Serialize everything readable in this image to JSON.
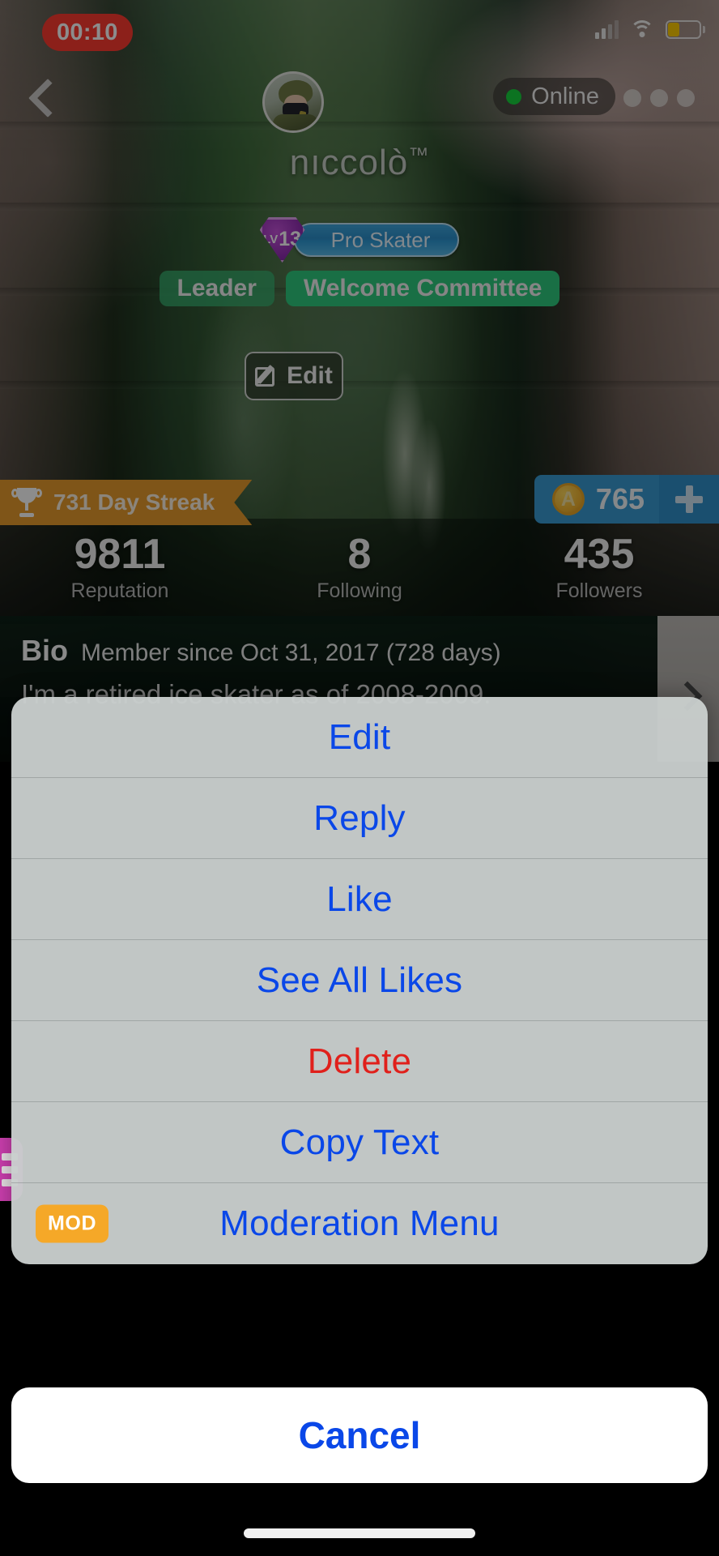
{
  "status_bar": {
    "recording_time": "00:10",
    "icons": [
      "signal-icon",
      "wifi-icon",
      "battery-icon"
    ]
  },
  "profile": {
    "back_icon": "back-chevron-icon",
    "more_icon": "more-dots-icon",
    "presence_label": "Online",
    "presence_color": "#17D13C",
    "avatar_alt": "avatar",
    "username": "nıccolò",
    "username_suffix": "™",
    "level_prefix": "LV",
    "level_number": "13",
    "title": "Pro Skater",
    "tags": [
      {
        "label": "Leader",
        "color": "#3AB270"
      },
      {
        "label": "Welcome Committee",
        "color": "#2FCB7E"
      }
    ],
    "edit_button": "Edit",
    "edit_icon": "edit-pencil-icon"
  },
  "streak": {
    "icon": "trophy-icon",
    "label": "731 Day Streak",
    "color": "#E89B2C"
  },
  "coins": {
    "icon": "coin-icon",
    "amount": "765",
    "add_icon": "plus-icon",
    "color": "#3A9BD4"
  },
  "stats": [
    {
      "value": "9811",
      "label": "Reputation"
    },
    {
      "value": "8",
      "label": "Following"
    },
    {
      "value": "435",
      "label": "Followers"
    }
  ],
  "bio": {
    "heading": "Bio",
    "member_since": "Member since Oct 31, 2017 (728 days)",
    "text": "I'm a retired ice skater as of 2008-2009.",
    "chevron_icon": "chevron-right-icon"
  },
  "edge_tab": {
    "icon": "menu-lines-icon",
    "color": "#CC3FAF"
  },
  "action_sheet": {
    "accent_color": "#0A47E8",
    "destructive_color": "#E0201B",
    "items": [
      {
        "label": "Edit",
        "style": "default"
      },
      {
        "label": "Reply",
        "style": "default"
      },
      {
        "label": "Like",
        "style": "default"
      },
      {
        "label": "See All Likes",
        "style": "default"
      },
      {
        "label": "Delete",
        "style": "destructive"
      },
      {
        "label": "Copy Text",
        "style": "default"
      },
      {
        "label": "Moderation Menu",
        "style": "default",
        "badge": "MOD",
        "badge_color": "#F5A828"
      }
    ],
    "cancel_label": "Cancel"
  }
}
